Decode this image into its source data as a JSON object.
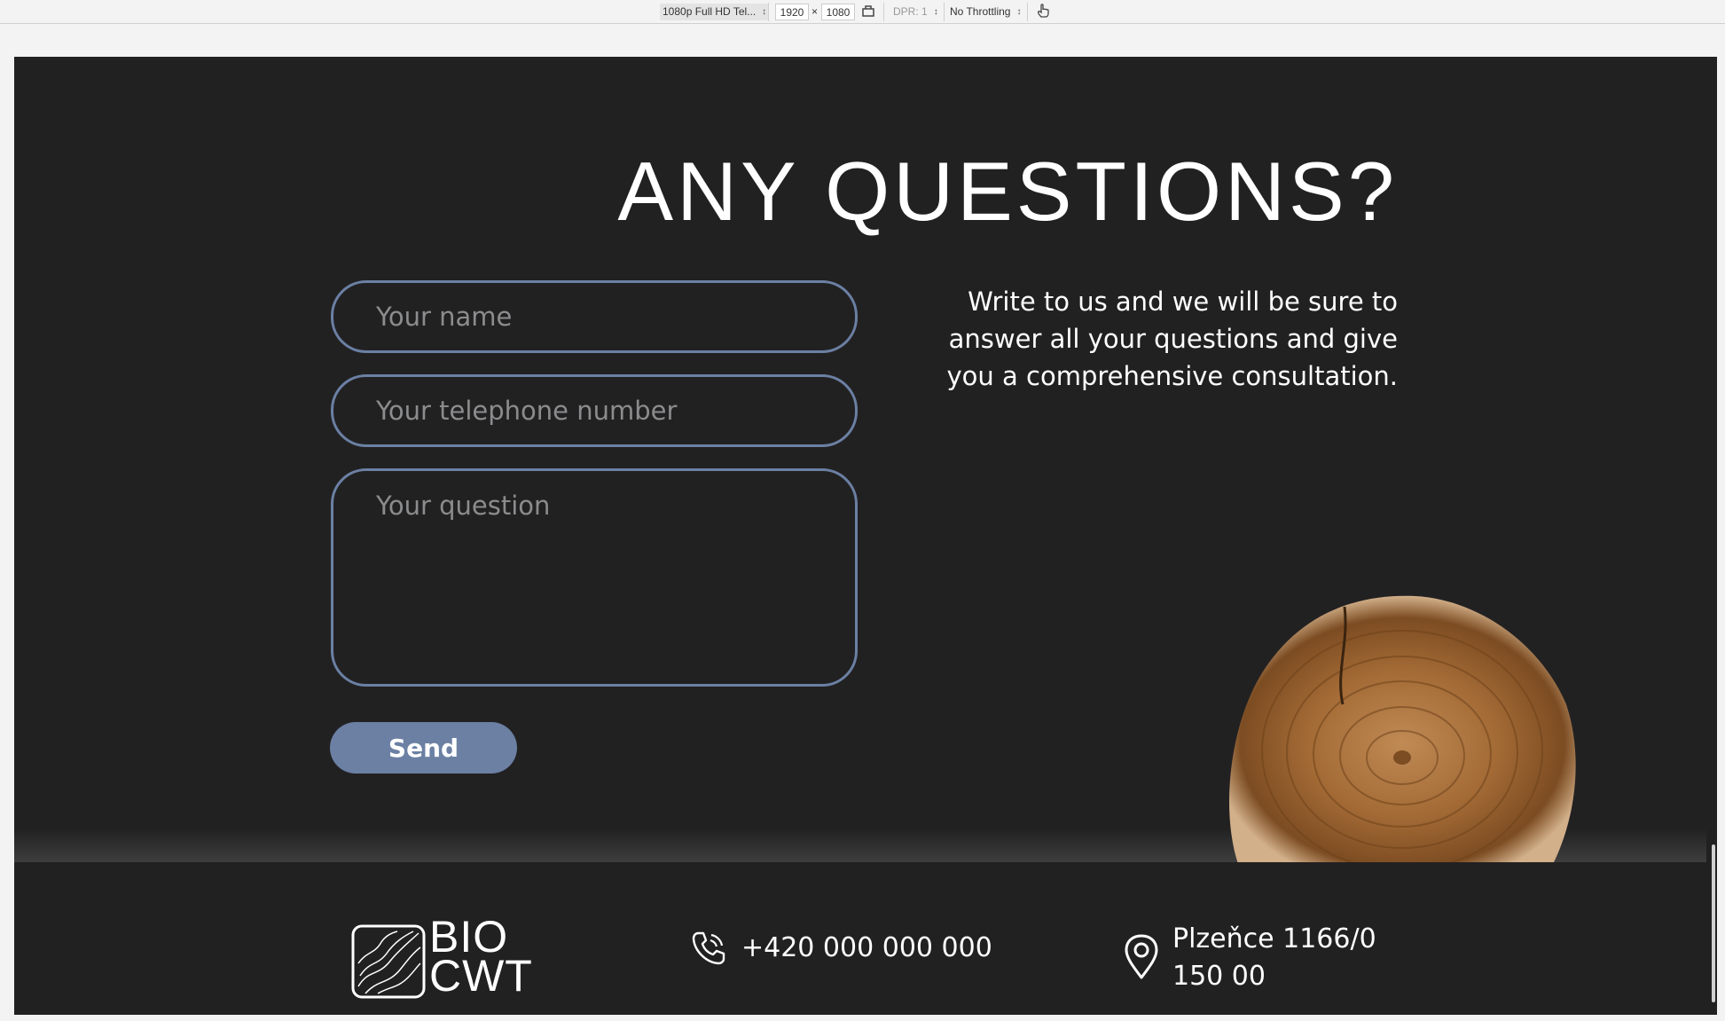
{
  "devtools": {
    "device": "1080p Full HD Tel...",
    "width": "1920",
    "times": "×",
    "height": "1080",
    "dpr": "DPR: 1",
    "throttling": "No Throttling"
  },
  "contact_section": {
    "title": "ANY QUESTIONS?",
    "description": "Write to us and we will be sure to answer all your questions and give you a comprehensive consultation.",
    "name_placeholder": "Your name",
    "phone_placeholder": "Your telephone number",
    "question_placeholder": "Your question",
    "send_label": "Send"
  },
  "footer": {
    "logo_line1": "BIO",
    "logo_line2": "CWT",
    "phone": "+420 000 000 000",
    "address_line1": "Plzeňce 1166/0",
    "address_line2": "150 00"
  },
  "colors": {
    "background": "#222122",
    "accent": "#6b80a3",
    "text": "#ffffff"
  },
  "icons": [
    "rotate-icon",
    "touch-icon",
    "phone-icon",
    "location-pin-icon",
    "topographic-logo-icon"
  ]
}
